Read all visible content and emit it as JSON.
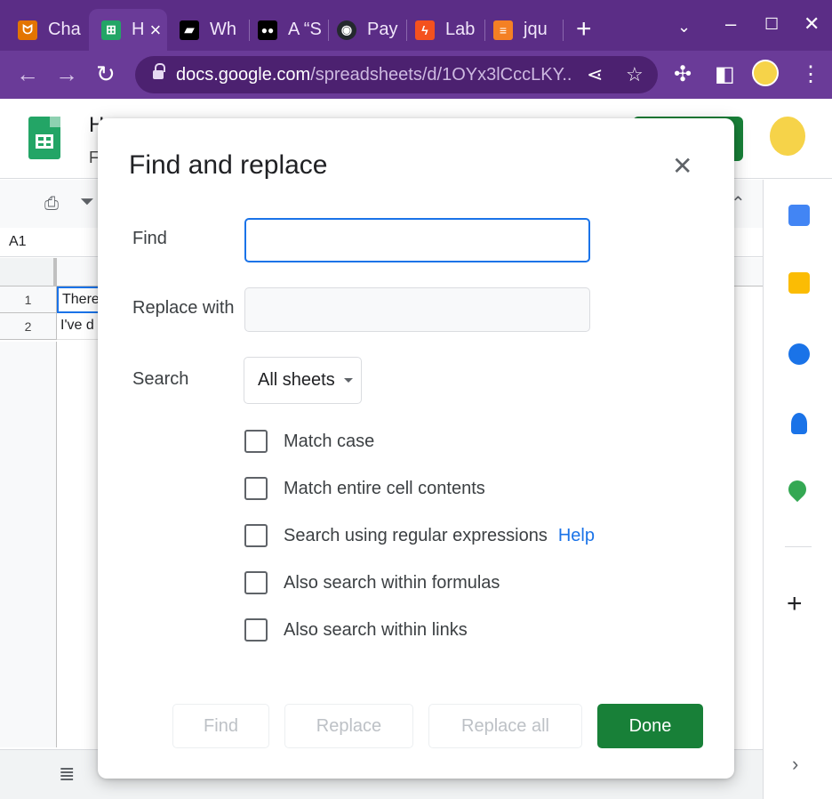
{
  "browser": {
    "tabs": [
      {
        "label": "Cha",
        "icon": "chat-favicon",
        "color": "#e37400"
      },
      {
        "label": "H",
        "icon": "sheets-favicon",
        "color": "#23a566",
        "active": true
      },
      {
        "label": "Wh",
        "icon": "book-favicon",
        "color": "#000000"
      },
      {
        "label": "A “S",
        "icon": "medium-favicon",
        "color": "#000000"
      },
      {
        "label": "Pay",
        "icon": "github-favicon",
        "color": "#24292e"
      },
      {
        "label": "Lab",
        "icon": "lab-favicon",
        "color": "#f4511e"
      },
      {
        "label": "jqu",
        "icon": "stackoverflow-favicon",
        "color": "#f48024"
      }
    ],
    "url_host": "docs.google.com",
    "url_path": "/spreadsheets/d/1OYx3lCccLKY..."
  },
  "sheet": {
    "title": "H",
    "subtitle": "F",
    "name_box": "A1",
    "rows": [
      {
        "num": "1",
        "cell": "There"
      },
      {
        "num": "2",
        "cell": "I've d"
      }
    ]
  },
  "dialog": {
    "title": "Find and replace",
    "find_label": "Find",
    "find_value": "",
    "replace_label": "Replace with",
    "replace_value": "",
    "search_label": "Search",
    "search_value": "All sheets",
    "options": [
      {
        "label": "Match case",
        "checked": false
      },
      {
        "label": "Match entire cell contents",
        "checked": false
      },
      {
        "label": "Search using regular expressions",
        "checked": false,
        "link": "Help"
      },
      {
        "label": "Also search within formulas",
        "checked": false
      },
      {
        "label": "Also search within links",
        "checked": false
      }
    ],
    "buttons": {
      "find": "Find",
      "replace": "Replace",
      "replace_all": "Replace all",
      "done": "Done"
    },
    "accent_color": "#188038",
    "focus_color": "#1a73e8"
  }
}
